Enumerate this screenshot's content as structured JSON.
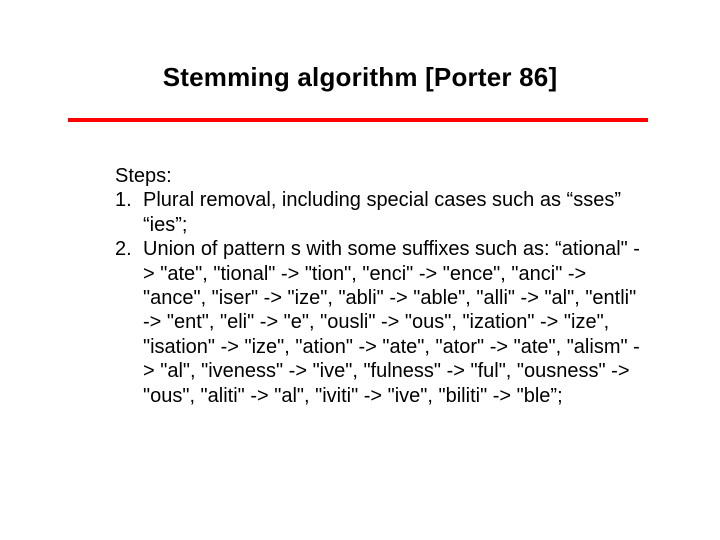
{
  "title": "Stemming algorithm [Porter 86]",
  "body": {
    "steps_label": "Steps:",
    "items": [
      {
        "num": "1.",
        "text": "  Plural removal, including special cases such as “sses” “ies”;"
      },
      {
        "num": "2.",
        "text": "  Union of pattern s with some suffixes such as: “ational\" -> \"ate\", \"tional\" -> \"tion\", \"enci\" -> \"ence\", \"anci\" -> \"ance\", \"iser\" -> \"ize\", \"abli\" -> \"able\", \"alli\" -> \"al\", \"entli\" -> \"ent\", \"eli\" -> \"e\", \"ousli\" -> \"ous\", \"ization\" -> \"ize\", \"isation\" -> \"ize\", \"ation\" -> \"ate\", \"ator\" -> \"ate\", \"alism\" -> \"al\", \"iveness\" -> \"ive\", \"fulness\" -> \"ful\", \"ousness\" -> \"ous\", \"aliti\" -> \"al\", \"iviti\" -> \"ive\", \"biliti\" -> \"ble”;"
      }
    ]
  }
}
